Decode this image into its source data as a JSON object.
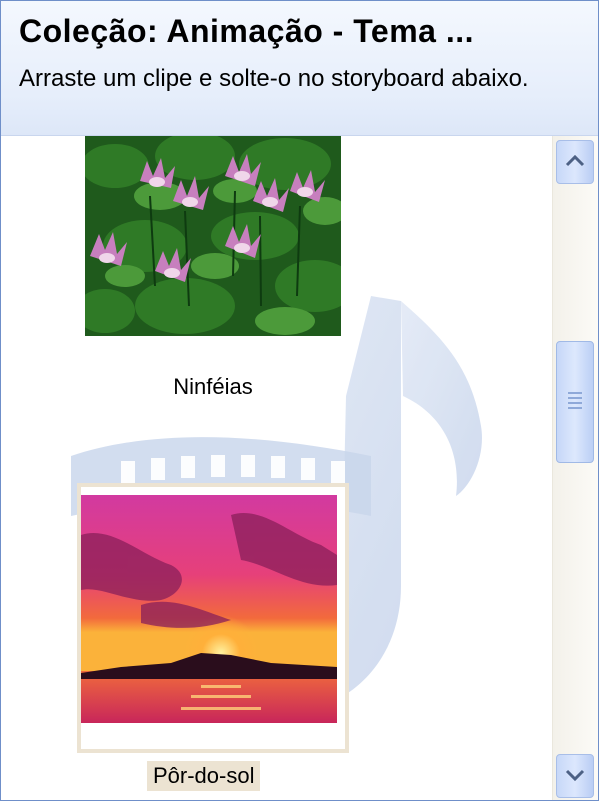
{
  "header": {
    "title": "Coleção: Animação - Tema ...",
    "subtitle": "Arraste um clipe e solte-o no storyboard abaixo."
  },
  "clips": [
    {
      "label": "Ninféias",
      "selected": false
    },
    {
      "label": "Pôr-do-sol",
      "selected": true
    }
  ],
  "background_icon": "music-film-icon",
  "colors": {
    "accent": "#6f8fc9",
    "selection": "#ece3d2",
    "scrollbar": "#c7d8f8"
  }
}
